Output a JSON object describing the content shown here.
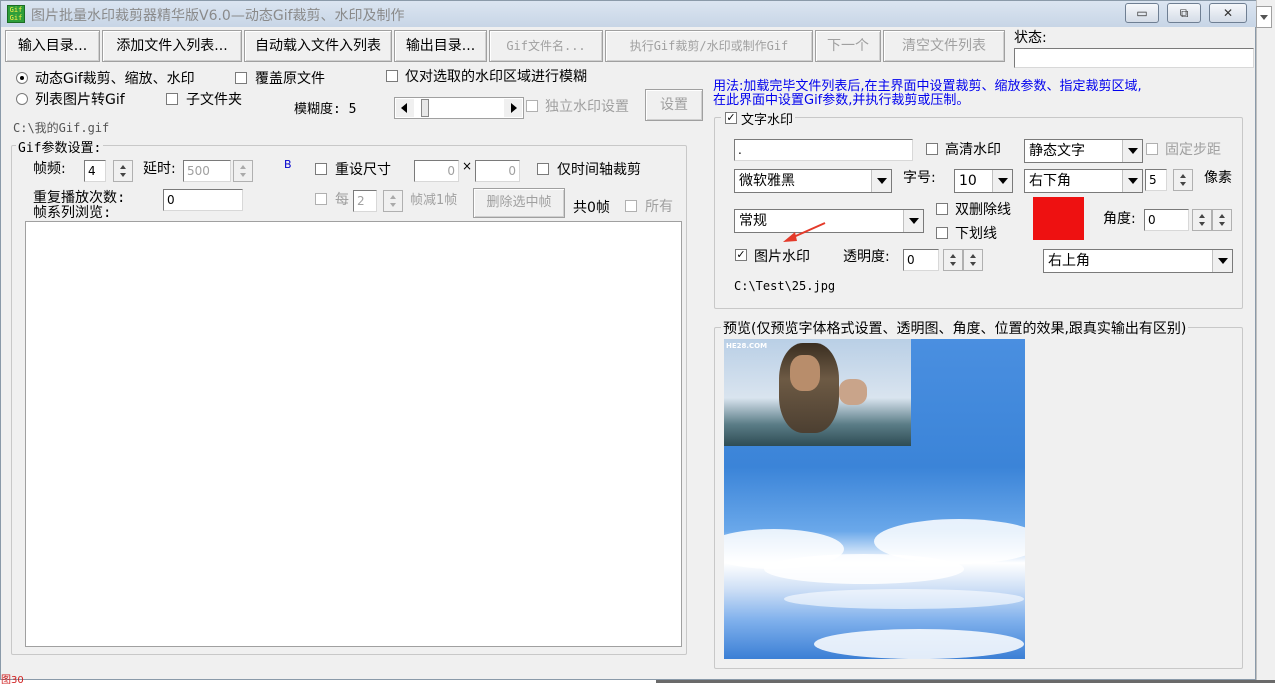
{
  "window": {
    "title": "图片批量水印裁剪器精华版V6.0—动态Gif裁剪、水印及制作",
    "icon_text": "Gif Gif",
    "min_glyph": "▭",
    "max_glyph": "⧉",
    "close_glyph": "✕"
  },
  "toolbar": {
    "input_dir": "输入目录...",
    "add_files": "添加文件入列表...",
    "auto_load": "自动载入文件入列表",
    "output_dir": "输出目录...",
    "gif_name": "Gif文件名...",
    "execute": "执行Gif裁剪/水印或制作Gif",
    "next": "下一个",
    "clear_list": "清空文件列表",
    "status_label": "状态:"
  },
  "options": {
    "mode_gif": "动态Gif裁剪、缩放、水印",
    "mode_list": "列表图片转Gif",
    "overwrite": "覆盖原文件",
    "subfolder": "子文件夹",
    "blur_selected": "仅对选取的水印区域进行模糊",
    "blur_label": "模糊度: 5",
    "independent_wm": "独立水印设置",
    "settings_btn": "设置",
    "file_path": "C:\\我的Gif.gif"
  },
  "gif_params": {
    "group_title": "Gif参数设置:",
    "frame_rate_label": "帧频:",
    "frame_rate_value": "4",
    "delay_label": "延时:",
    "delay_value": "500",
    "b_label": "B",
    "resize_label": "重设尺寸",
    "width_value": "0",
    "x_sep": "×",
    "height_value": "0",
    "time_axis_crop": "仅时间轴裁剪",
    "repeat_label": "重复播放次数:",
    "repeat_value": "0",
    "frame_browse_label": "帧系列浏览:",
    "every_label": "每",
    "every_value": "2",
    "reduce_label": "帧减1帧",
    "delete_selected": "删除选中帧",
    "total_frames": "共0帧",
    "all_label": "所有"
  },
  "usage_hint": {
    "line1": "用法:加载完毕文件列表后,在主界面中设置裁剪、缩放参数、指定裁剪区域,",
    "line2": "在此界面中设置Gif参数,并执行裁剪或压制。"
  },
  "text_wm": {
    "title": "文字水印",
    "text_value": ".",
    "hd_label": "高清水印",
    "mode_value": "静态文字",
    "fixed_step": "固定步距",
    "font_value": "微软雅黑",
    "size_label": "字号:",
    "size_value": "10",
    "position_value": "右下角",
    "offset_value": "5",
    "px_label": "像素",
    "style_value": "常规",
    "strike_label": "双删除线",
    "underline_label": "下划线",
    "color_hex": "#ee1111",
    "angle_label": "角度:",
    "angle_value": "0"
  },
  "image_wm": {
    "label": "图片水印",
    "opacity_label": "透明度:",
    "opacity_value": "0",
    "position_value": "右上角",
    "path": "C:\\Test\\25.jpg"
  },
  "preview": {
    "title": "预览(仅预览字体格式设置、透明图、角度、位置的效果,跟真实输出有区别)",
    "site_text": "HE28.COM"
  },
  "bottom_hint": "图30"
}
